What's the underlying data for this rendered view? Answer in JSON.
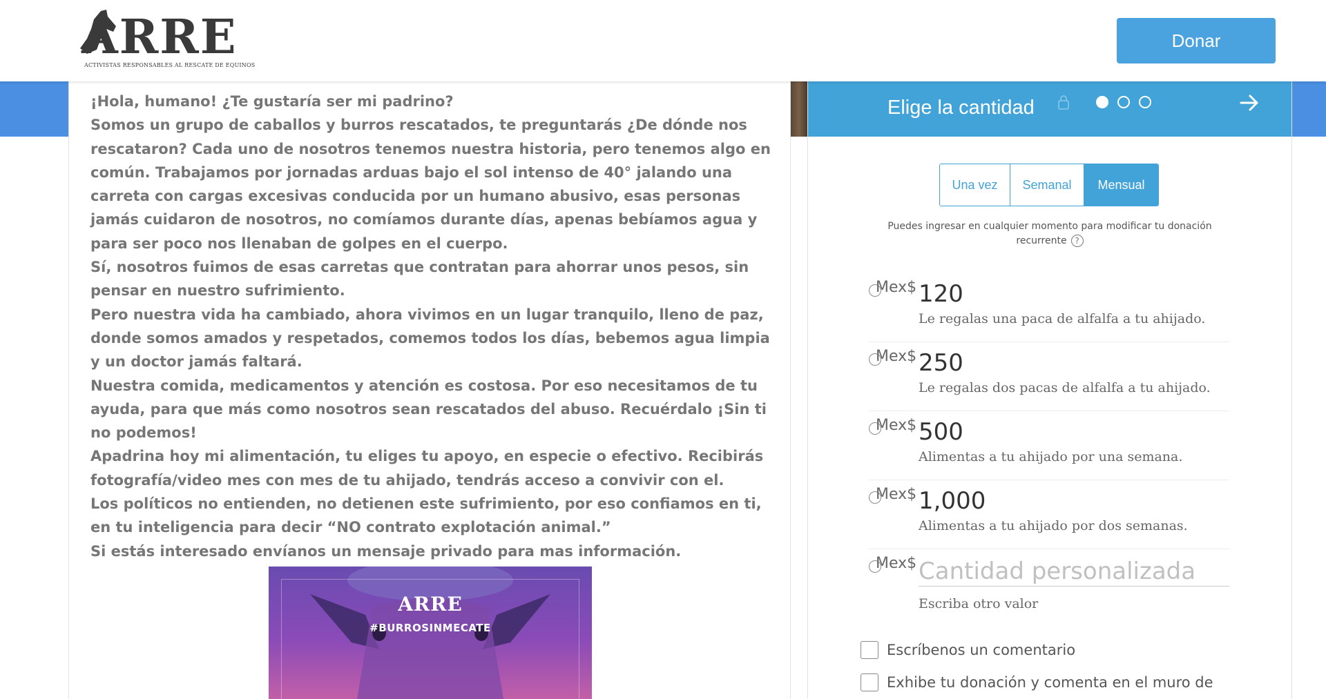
{
  "header": {
    "logo_text": "ARRE",
    "logo_tagline": "ACTIVISTAS RESPONSABLES AL RESCATE DE EQUINOS",
    "donate_button": "Donar"
  },
  "story": {
    "paragraphs": [
      "¡Hola, humano! ¿Te gustaría ser mi padrino?",
      "Somos un grupo de caballos y burros rescatados, te preguntarás ¿De dónde nos rescataron? Cada uno de nosotros tenemos nuestra historia, pero tenemos algo en común. Trabajamos por jornadas arduas bajo el sol intenso de 40° jalando una carreta con cargas excesivas conducida por un humano abusivo, esas personas jamás cuidaron de nosotros, no comíamos durante días, apenas bebíamos agua y para ser poco nos llenaban de golpes en el cuerpo.",
      "Sí, nosotros fuimos de esas carretas que contratan para ahorrar unos pesos, sin pensar en nuestro sufrimiento.",
      "Pero nuestra vida ha cambiado, ahora vivimos en un lugar tranquilo, lleno de paz, donde somos amados y respetados, comemos todos los días, bebemos agua limpia y un doctor jamás faltará.",
      "Nuestra comida, medicamentos y atención es costosa. Por eso necesitamos de tu ayuda, para que más como nosotros sean rescatados del abuso. Recuérdalo ¡Sin ti no podemos!",
      "Apadrina hoy mi alimentación, tu eliges tu apoyo, en especie o efectivo. Recibirás fotografía/video mes con mes de tu ahijado, tendrás acceso a convivir con el.",
      "Los políticos no entienden, no detienen este sufrimiento, por eso confiamos en ti, en tu inteligencia para decir “NO contrato explotación animal.”",
      "Si estás interesado envíanos un mensaje privado para mas información."
    ],
    "promo_logo": "ARRE",
    "promo_hashtag": "#BURROSINMECATE"
  },
  "donation": {
    "title": "Elige la cantidad",
    "steps": {
      "current": 1,
      "total": 3
    },
    "frequency": {
      "options": [
        "Una vez",
        "Semanal",
        "Mensual"
      ],
      "selected": "Mensual"
    },
    "recurring_note": "Puedes ingresar en cualquier momento para modificar tu donación recurrente",
    "currency": "Mex$",
    "amounts": [
      {
        "value": "120",
        "description": "Le regalas una paca de alfalfa a tu ahijado."
      },
      {
        "value": "250",
        "description": "Le regalas dos pacas de alfalfa a tu ahijado."
      },
      {
        "value": "500",
        "description": "Alimentas a tu ahijado por una semana."
      },
      {
        "value": "1,000",
        "description": "Alimentas a tu ahijado por dos semanas."
      }
    ],
    "custom": {
      "placeholder": "Cantidad personalizada",
      "hint": "Escriba otro valor"
    },
    "options": {
      "comment": "Escríbenos un comentario",
      "wall": "Exhibe tu donación y comenta en el muro de"
    }
  }
}
